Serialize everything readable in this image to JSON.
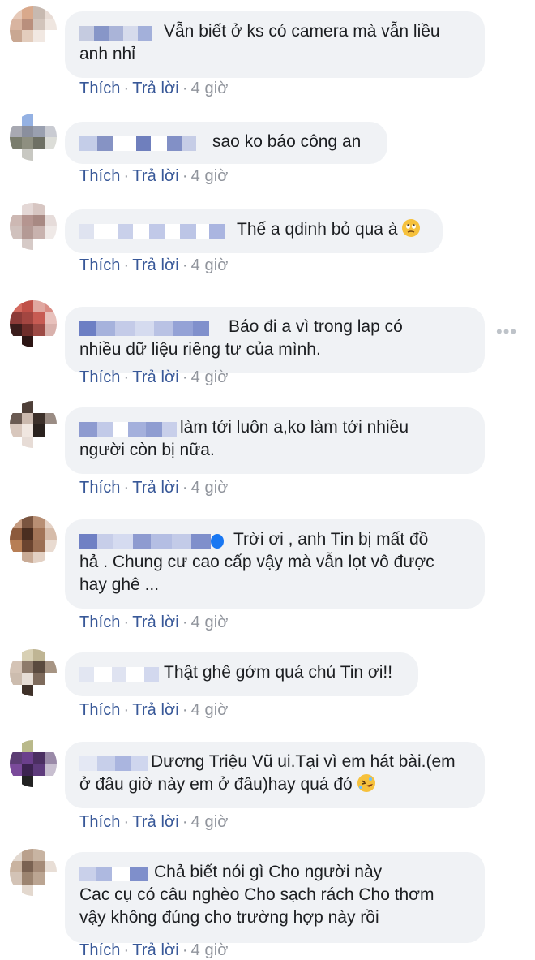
{
  "comments": [
    {
      "text": "Vẫn biết ở ks có camera mà vẫn liều anh nhỉ",
      "line1": "Vẫn biết ở ks có camera mà vẫn liều",
      "line2": "anh nhỉ",
      "like": "Thích",
      "reply": "Trả lời",
      "time": "4 giờ"
    },
    {
      "text": "sao ko báo công an",
      "like": "Thích",
      "reply": "Trả lời",
      "time": "4 giờ"
    },
    {
      "text": "Thế a qdinh bỏ qua à",
      "like": "Thích",
      "reply": "Trả lời",
      "time": "4 giờ",
      "emoji": "face-with-rolling-eyes"
    },
    {
      "line1": "Báo đi a vì trong lap có",
      "line2": "nhiều dữ liệu riêng tư của mình.",
      "like": "Thích",
      "reply": "Trả lời",
      "time": "4 giờ"
    },
    {
      "line1": "làm tới luôn a,ko làm tới nhiều",
      "line2": "người còn bị nữa.",
      "like": "Thích",
      "reply": "Trả lời",
      "time": "4 giờ"
    },
    {
      "line1": "Trời ơi , anh Tin bị mất đồ",
      "line2": "hả . Chung cư cao cấp vậy mà vẫn lọt vô được",
      "line3": "hay ghê ...",
      "like": "Thích",
      "reply": "Trả lời",
      "time": "4 giờ"
    },
    {
      "text": "Thật ghê gớm quá chú Tin ơi!!",
      "like": "Thích",
      "reply": "Trả lời",
      "time": "4 giờ"
    },
    {
      "line1": "Dương Triệu Vũ ui.Tại vì em hát bài.(em",
      "line2": "ở đâu giờ này em ở đâu)hay quá đó",
      "like": "Thích",
      "reply": "Trả lời",
      "time": "4 giờ",
      "emoji": "rolling-on-floor-laughing"
    },
    {
      "line1": "Chả biết nói gì Cho người này",
      "line2": "Cac cụ có câu nghèo Cho sạch rách Cho thơm",
      "line3": "vậy không đúng cho trường hợp này rồi",
      "like": "Thích",
      "reply": "Trả lời",
      "time": "4 giờ"
    }
  ],
  "more_label": "•••",
  "colors": {
    "bubble": "#f0f2f5",
    "link": "#385898",
    "muted": "#90949c"
  }
}
